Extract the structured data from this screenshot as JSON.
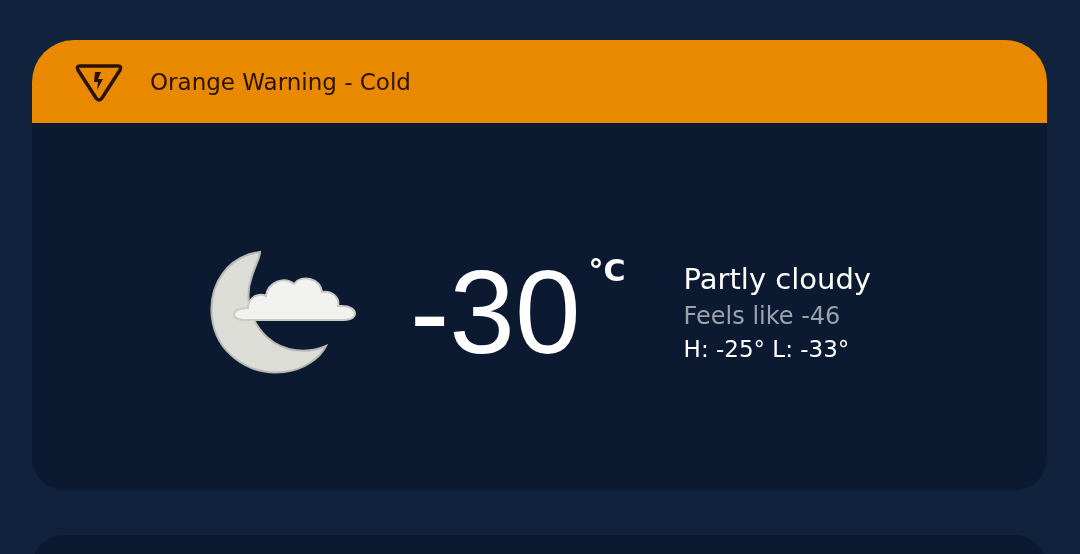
{
  "warning": {
    "text": "Orange Warning - Cold"
  },
  "current": {
    "temperature": "-30",
    "unit": "°C",
    "condition": "Partly cloudy",
    "feels_like": "Feels like -46",
    "high_low": "H: -25° L: -33°"
  }
}
